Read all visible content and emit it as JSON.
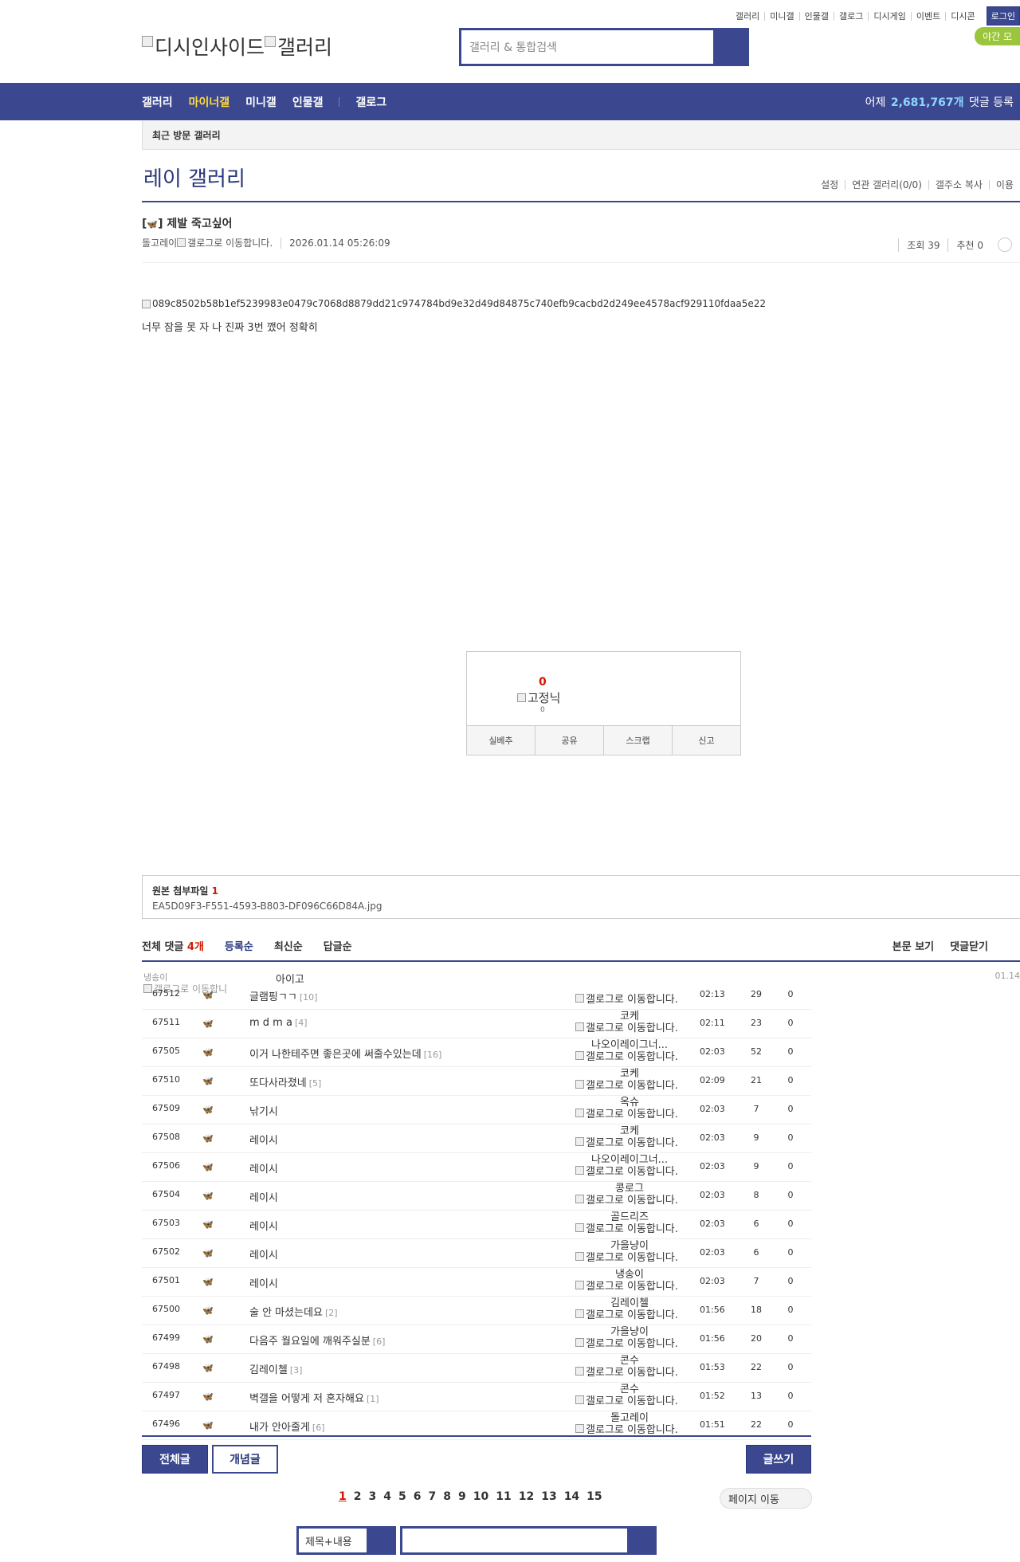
{
  "util_nav": [
    "갤러리",
    "미니갤",
    "인물갤",
    "갤로그",
    "디시게임",
    "이벤트",
    "디시콘"
  ],
  "login_label": "로그인",
  "night_label": "야간 모",
  "logo": {
    "left": "디시인사이드",
    "right": "갤러리"
  },
  "search": {
    "placeholder": "갤러리 & 통합검색"
  },
  "gnb": {
    "items": [
      "갤러리",
      "마이너갤",
      "미니갤",
      "인물갤",
      "갤로그"
    ],
    "stat_prefix": "어제",
    "stat_value": "2,681,767개",
    "stat_suffix": "댓글 등록"
  },
  "recent_label": "최근 방문 갤러리",
  "gallery": {
    "title": "레이 갤러리",
    "links": [
      "설정",
      "연관 갤러리(0/0)",
      "갤주소 복사",
      "이용"
    ]
  },
  "post": {
    "title_prefix": "[",
    "title_icon": "🦋",
    "title_text": "] 제발 죽고싶어",
    "author": "돌고레이",
    "gallog_alt": "갤로그로 이동합니다.",
    "date": "2026.01.14 05:26:09",
    "views_label": "조회 39",
    "recommend_label": "추천 0",
    "image_alt": "089c8502b58b1ef5239983e0479c7068d8879dd21c974784bd9e32d49d84875c740efb9cacbd2d249ee4578acf929110fdaa5e22",
    "body": "너무 잠을 못 자 나 진짜 3번 깼어 정확히"
  },
  "vote": {
    "count": "0",
    "fixed_alt": "고정닉",
    "fixed_count": "0",
    "buttons": [
      "실베추",
      "공유",
      "스크랩",
      "신고"
    ]
  },
  "attachment": {
    "label": "원본 첨부파일",
    "count": "1",
    "file": "EA5D09F3-F551-4593-B803-DF096C66D84A.jpg"
  },
  "comments": {
    "total_label": "전체 댓글",
    "total_count": "4개",
    "tabs": [
      "등록순",
      "최신순",
      "답글순"
    ],
    "right": [
      "본문 보기",
      "댓글닫기"
    ]
  },
  "overlap": {
    "name": "냉송이",
    "text": "아이고",
    "date": "01.14",
    "gallog": "갤로그로 이동합니"
  },
  "rows": [
    {
      "num": "67512",
      "icon": "🦋",
      "title": "글램핑ㄱㄱ",
      "reply": "[10]",
      "writer": "",
      "gallog": "갤로그로 이동합니다.",
      "time": "02:13",
      "views": "29",
      "rec": "0"
    },
    {
      "num": "67511",
      "icon": "🦋",
      "title": "m d m a",
      "reply": "[4]",
      "writer": "코케",
      "gallog": "갤로그로 이동합니다.",
      "time": "02:11",
      "views": "23",
      "rec": "0"
    },
    {
      "num": "67505",
      "icon": "🦋",
      "title": "이거 나한테주면 좋은곳에 써줄수있는데",
      "reply": "[16]",
      "writer": "나오이레이그너...",
      "gallog": "갤로그로 이동합니다.",
      "time": "02:03",
      "views": "52",
      "rec": "0"
    },
    {
      "num": "67510",
      "icon": "🦋",
      "title": "또다사라졌네",
      "reply": "[5]",
      "writer": "코케",
      "gallog": "갤로그로 이동합니다.",
      "time": "02:09",
      "views": "21",
      "rec": "0"
    },
    {
      "num": "67509",
      "icon": "🦋",
      "title": "낚기시",
      "reply": "",
      "writer": "옥슈",
      "gallog": "갤로그로 이동합니다.",
      "time": "02:03",
      "views": "7",
      "rec": "0"
    },
    {
      "num": "67508",
      "icon": "🦋",
      "title": "레이시",
      "reply": "",
      "writer": "코케",
      "gallog": "갤로그로 이동합니다.",
      "time": "02:03",
      "views": "9",
      "rec": "0"
    },
    {
      "num": "67506",
      "icon": "🦋",
      "title": "레이시",
      "reply": "",
      "writer": "나오이레이그너...",
      "gallog": "갤로그로 이동합니다.",
      "time": "02:03",
      "views": "9",
      "rec": "0"
    },
    {
      "num": "67504",
      "icon": "🦋",
      "title": "레이시",
      "reply": "",
      "writer": "콩로그",
      "gallog": "갤로그로 이동합니다.",
      "time": "02:03",
      "views": "8",
      "rec": "0"
    },
    {
      "num": "67503",
      "icon": "🦋",
      "title": "레이시",
      "reply": "",
      "writer": "골드리즈",
      "gallog": "갤로그로 이동합니다.",
      "time": "02:03",
      "views": "6",
      "rec": "0"
    },
    {
      "num": "67502",
      "icon": "🦋",
      "title": "레이시",
      "reply": "",
      "writer": "가을냥이",
      "gallog": "갤로그로 이동합니다.",
      "time": "02:03",
      "views": "6",
      "rec": "0"
    },
    {
      "num": "67501",
      "icon": "🦋",
      "title": "레이시",
      "reply": "",
      "writer": "냉송이",
      "gallog": "갤로그로 이동합니다.",
      "time": "02:03",
      "views": "7",
      "rec": "0"
    },
    {
      "num": "67500",
      "icon": "🦋",
      "title": "술 안 마셨는데요",
      "reply": "[2]",
      "writer": "김레이첼",
      "gallog": "갤로그로 이동합니다.",
      "time": "01:56",
      "views": "18",
      "rec": "0"
    },
    {
      "num": "67499",
      "icon": "🦋",
      "title": "다음주 월요일에 깨워주실분",
      "reply": "[6]",
      "writer": "가을냥이",
      "gallog": "갤로그로 이동합니다.",
      "time": "01:56",
      "views": "20",
      "rec": "0"
    },
    {
      "num": "67498",
      "icon": "🦋",
      "title": "김레이첼",
      "reply": "[3]",
      "writer": "콘수",
      "gallog": "갤로그로 이동합니다.",
      "time": "01:53",
      "views": "22",
      "rec": "0"
    },
    {
      "num": "67497",
      "icon": "🦋",
      "title": "벽갤을 어떻게 저 혼자해요",
      "reply": "[1]",
      "writer": "콘수",
      "gallog": "갤로그로 이동합니다.",
      "time": "01:52",
      "views": "13",
      "rec": "0"
    },
    {
      "num": "67496",
      "icon": "🦋",
      "title": "내가 안아줄게",
      "reply": "[6]",
      "writer": "돌고레이",
      "gallog": "갤로그로 이동합니다.",
      "time": "01:51",
      "views": "22",
      "rec": "0"
    }
  ],
  "buttons": {
    "all": "전체글",
    "concept": "개념글",
    "write": "글쓰기"
  },
  "pages": [
    "1",
    "2",
    "3",
    "4",
    "5",
    "6",
    "7",
    "8",
    "9",
    "10",
    "11",
    "12",
    "13",
    "14",
    "15"
  ],
  "page_jump": "페이지 이동",
  "bottom_search": {
    "select": "제목+내용"
  },
  "colors": {
    "brand": "#3b4890",
    "accent": "#ffdd3c",
    "red": "#d31900"
  }
}
